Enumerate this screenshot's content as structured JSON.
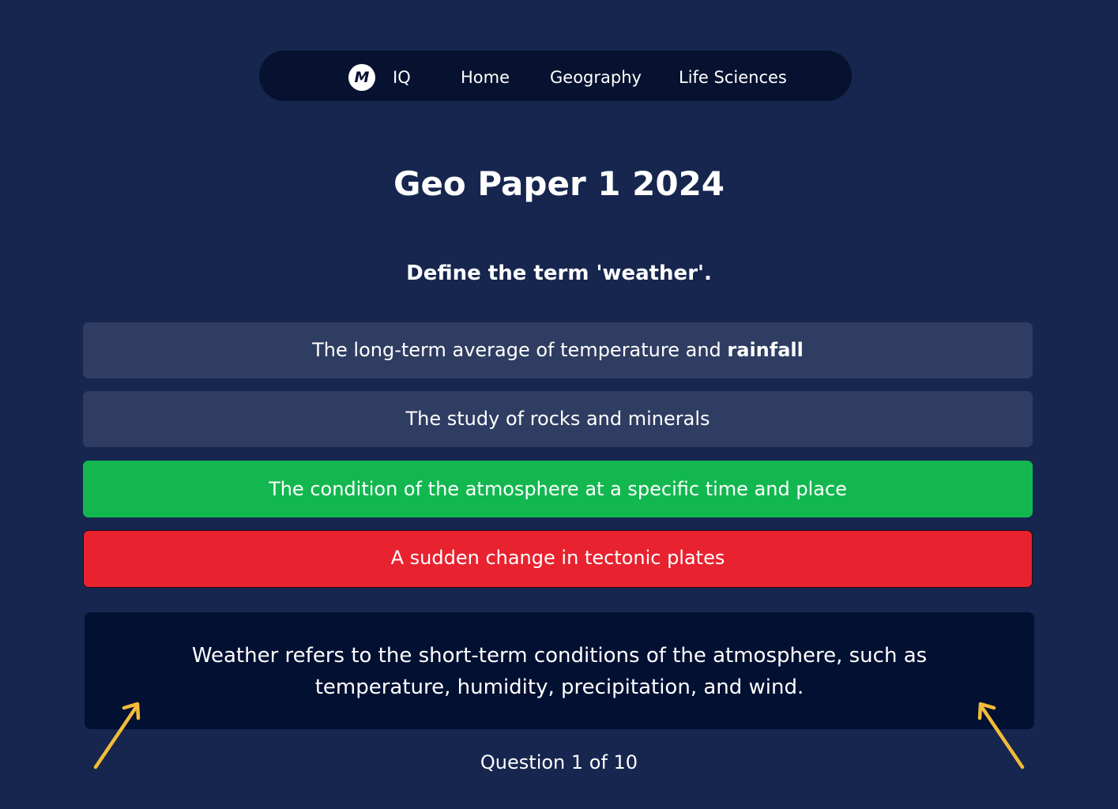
{
  "nav": {
    "logo_letter": "M",
    "brand": "IQ",
    "items": [
      {
        "label": "Home"
      },
      {
        "label": "Geography"
      },
      {
        "label": "Life Sciences"
      }
    ]
  },
  "page": {
    "title": "Geo Paper 1 2024",
    "question": "Define the term 'weather'."
  },
  "options": [
    {
      "text": "The long-term average of temperature and ",
      "emphasis": "rainfall",
      "state": "neutral"
    },
    {
      "text": "The study of rocks and minerals",
      "state": "neutral"
    },
    {
      "text": "The condition of the atmosphere at a specific time and place",
      "state": "correct"
    },
    {
      "text": "A sudden change in tectonic plates",
      "state": "wrong"
    }
  ],
  "explanation": {
    "text": "Weather refers to the short-term conditions of the atmosphere, such as temperature, humidity, precipitation, and wind."
  },
  "progress": {
    "label": "Question 1 of 10",
    "current": 1,
    "total": 10
  },
  "colors": {
    "background": "#16264f",
    "nav_background": "#06122f",
    "option_neutral": "#303d62",
    "option_correct": "#12b84f",
    "option_wrong": "#e8222f",
    "explanation_background": "#021032",
    "arrow": "#f2bb3a"
  },
  "icons": {
    "logo": "m-logo-icon",
    "arrows": "arrow-up-left-icon"
  }
}
